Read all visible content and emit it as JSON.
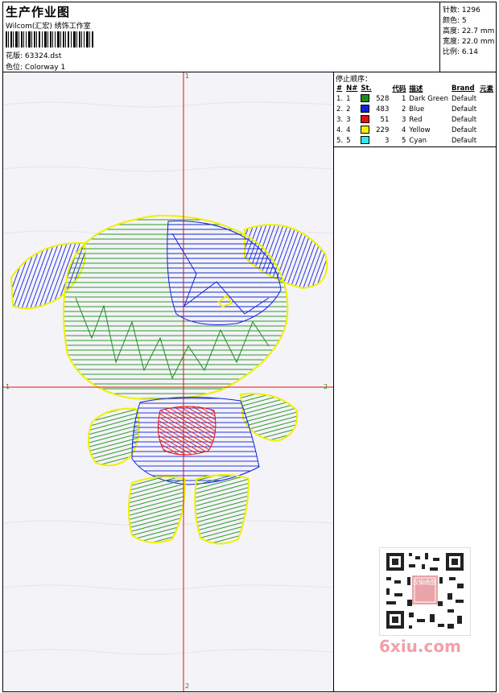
{
  "header": {
    "title": "生产作业图",
    "company": "Wilcom(汇宏) 绣饰工作室",
    "design_file_label": "花版:",
    "design_file": "63324.dst",
    "colorway_label": "色位:",
    "colorway": "Colorway 1"
  },
  "specs": [
    {
      "label": "针数:",
      "value": "1296"
    },
    {
      "label": "颜色:",
      "value": "5"
    },
    {
      "label": "高度:",
      "value": "22.7 mm"
    },
    {
      "label": "宽度:",
      "value": "22.0 mm"
    },
    {
      "label": "比例:",
      "value": "6.14"
    }
  ],
  "stop_sequence": {
    "title": "停止顺序：",
    "columns": [
      "#",
      "N#",
      "St.",
      "代码",
      "描述",
      "Brand",
      "元素"
    ],
    "rows": [
      {
        "num": "1.",
        "n": "1",
        "color": "#1a8f1a",
        "stitches": "528",
        "code": "1",
        "desc": "Dark Green",
        "brand": "Default"
      },
      {
        "num": "2.",
        "n": "2",
        "color": "#1020e0",
        "stitches": "483",
        "code": "2",
        "desc": "Blue",
        "brand": "Default"
      },
      {
        "num": "3.",
        "n": "3",
        "color": "#e01010",
        "stitches": "51",
        "code": "3",
        "desc": "Red",
        "brand": "Default"
      },
      {
        "num": "4.",
        "n": "4",
        "color": "#f0f000",
        "stitches": "229",
        "code": "4",
        "desc": "Yellow",
        "brand": "Default"
      },
      {
        "num": "5.",
        "n": "5",
        "color": "#30e8f0",
        "stitches": "3",
        "code": "5",
        "desc": "Cyan",
        "brand": "Default"
      }
    ]
  },
  "axes": {
    "top": "1",
    "bottom": "2",
    "left": "1",
    "right": "2"
  },
  "watermark": {
    "text": "6xiu.com",
    "stamp": "汉锦绣图"
  },
  "colors": {
    "axis": "#e01010",
    "green": "#1a8f1a",
    "blue": "#1020e0",
    "red": "#e01010",
    "yellow": "#f0f000"
  }
}
